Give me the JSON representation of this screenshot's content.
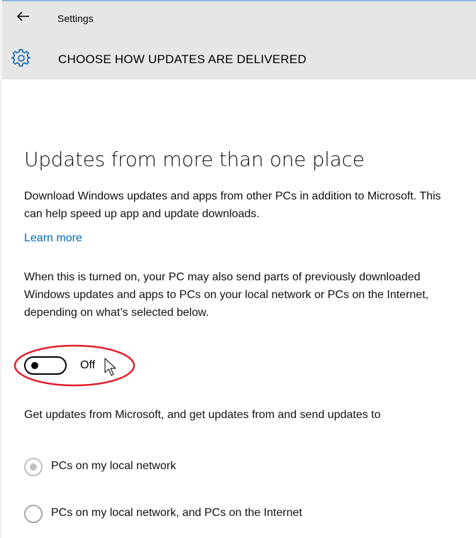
{
  "header": {
    "back_icon": "back-arrow-icon",
    "app_title": "Settings",
    "page_icon": "gear-icon",
    "page_heading": "CHOOSE HOW UPDATES ARE DELIVERED"
  },
  "content": {
    "section_title": "Updates from more than one place",
    "description": "Download Windows updates and apps from other PCs in addition to Microsoft. This can help speed up app and update downloads.",
    "learn_more": "Learn more",
    "explanation": "When this is turned on, your PC may also send parts of previously downloaded Windows updates and apps to PCs on your local network or PCs on the Internet, depending on what’s selected below.",
    "toggle": {
      "state": "off",
      "label": "Off"
    },
    "sources_prompt": "Get updates from Microsoft, and get updates from and send updates to",
    "options": [
      {
        "label": "PCs on my local network",
        "selected": true,
        "disabled": true
      },
      {
        "label": "PCs on my local network, and PCs on the Internet",
        "selected": false,
        "disabled": true
      }
    ]
  },
  "colors": {
    "header_bg": "#e6e6e6",
    "link": "#0067b8",
    "highlight_ring": "#e0202a",
    "disabled_radio": "#bfbfbf"
  }
}
